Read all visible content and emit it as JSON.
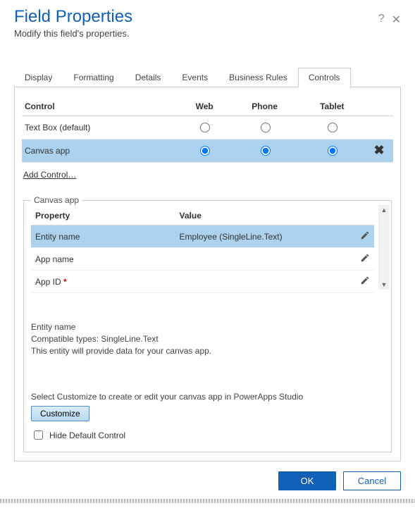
{
  "header": {
    "title": "Field Properties",
    "subtitle": "Modify this field's properties."
  },
  "tabs": [
    "Display",
    "Formatting",
    "Details",
    "Events",
    "Business Rules",
    "Controls"
  ],
  "controls_table": {
    "headers": {
      "control": "Control",
      "web": "Web",
      "phone": "Phone",
      "tablet": "Tablet"
    },
    "rows": [
      {
        "label": "Text Box (default)"
      },
      {
        "label": "Canvas app"
      }
    ]
  },
  "add_control_link": "Add Control…",
  "props_fieldset_legend": "Canvas app",
  "props_table": {
    "headers": {
      "property": "Property",
      "value": "Value"
    },
    "rows": [
      {
        "property": "Entity name",
        "value": "Employee (SingleLine.Text)",
        "required": false
      },
      {
        "property": "App name",
        "value": "",
        "required": false
      },
      {
        "property": "App ID",
        "value": "",
        "required": true
      }
    ]
  },
  "description": {
    "title": "Entity name",
    "line1": "Compatible types: SingleLine.Text",
    "line2": "This entity will provide data for your canvas app."
  },
  "customize_hint": "Select Customize to create or edit your canvas app in PowerApps Studio",
  "customize_button": "Customize",
  "hide_default_label": "Hide Default Control",
  "footer": {
    "ok": "OK",
    "cancel": "Cancel"
  }
}
